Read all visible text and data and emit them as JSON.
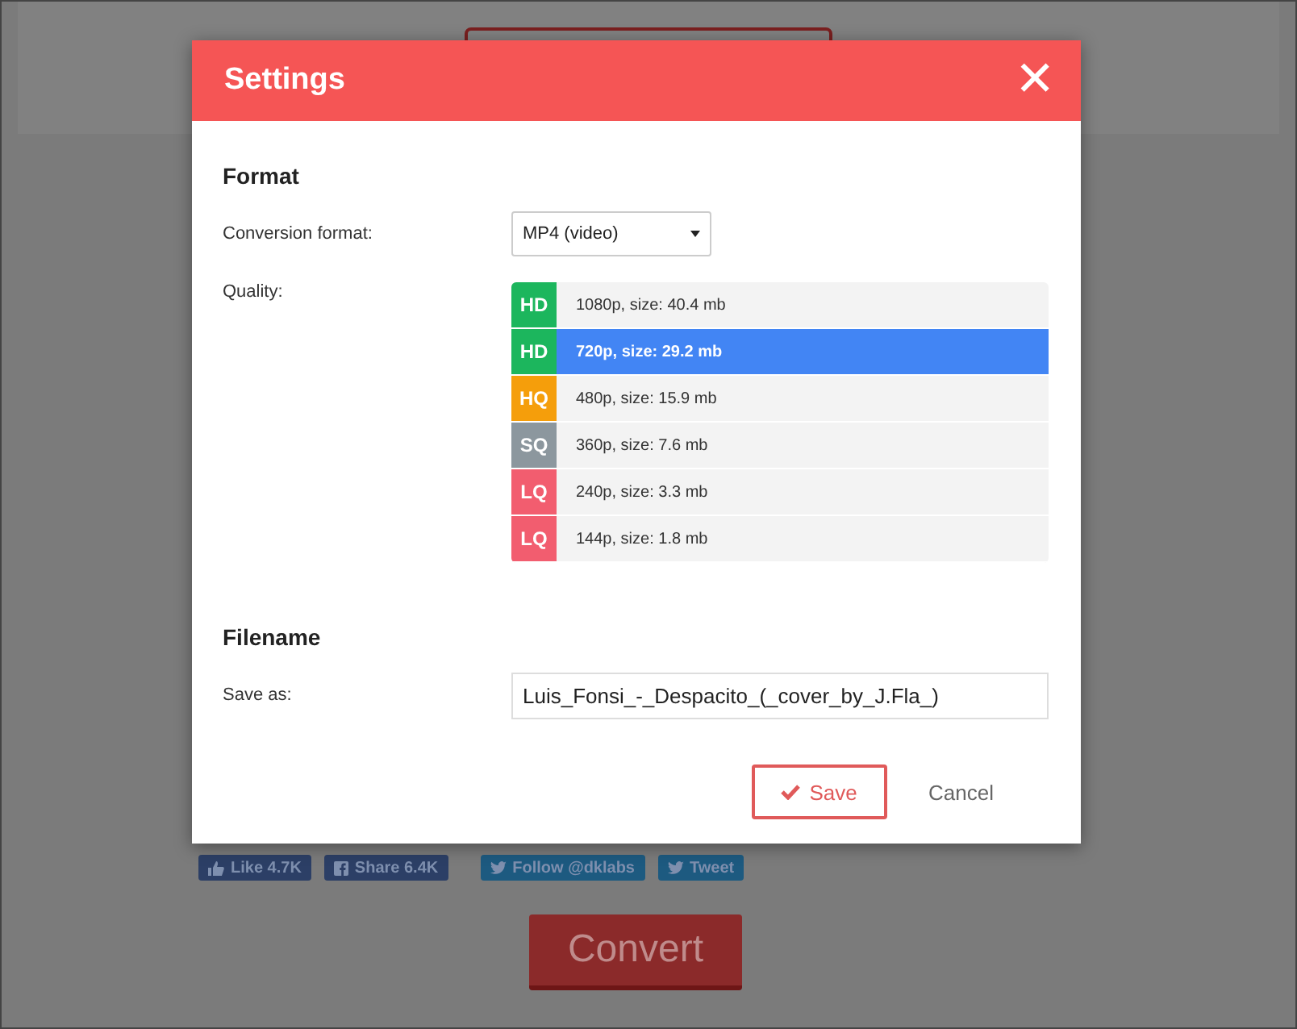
{
  "dialog": {
    "title": "Settings",
    "close_symbol": "✕"
  },
  "format_section": {
    "heading": "Format",
    "conversion_label": "Conversion format:",
    "conversion_value": "MP4 (video)",
    "quality_label": "Quality:",
    "qualities": [
      {
        "badge": "HD",
        "color": "#1cb65d",
        "text": "1080p, size: 40.4 mb",
        "selected": false
      },
      {
        "badge": "HD",
        "color": "#1cb65d",
        "text": "720p, size: 29.2 mb",
        "selected": true
      },
      {
        "badge": "HQ",
        "color": "#f59e0b",
        "text": "480p, size: 15.9 mb",
        "selected": false
      },
      {
        "badge": "SQ",
        "color": "#8c979e",
        "text": "360p, size: 7.6 mb",
        "selected": false
      },
      {
        "badge": "LQ",
        "color": "#f25d6f",
        "text": "240p, size: 3.3 mb",
        "selected": false
      },
      {
        "badge": "LQ",
        "color": "#f25d6f",
        "text": "144p, size: 1.8 mb",
        "selected": false
      }
    ]
  },
  "filename_section": {
    "heading": "Filename",
    "label": "Save as:",
    "value": "Luis_Fonsi_-_Despacito_(_cover_by_J.Fla_)"
  },
  "buttons": {
    "save": "Save",
    "cancel": "Cancel"
  },
  "background": {
    "social": [
      {
        "kind": "like",
        "label": "Like 4.7K"
      },
      {
        "kind": "share",
        "label": "Share 6.4K"
      },
      {
        "kind": "follow",
        "label": "Follow @dklabs"
      },
      {
        "kind": "tweet",
        "label": "Tweet"
      }
    ],
    "convert": "Convert"
  }
}
